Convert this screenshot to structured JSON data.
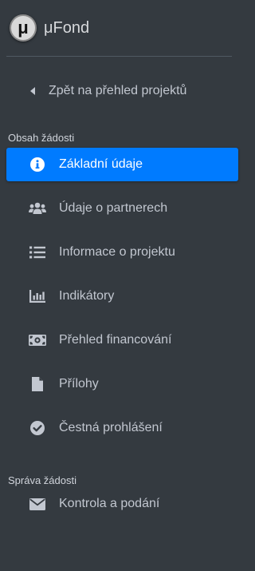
{
  "brand": {
    "logo_letter": "μ",
    "name": "μFond"
  },
  "back": {
    "label": "Zpět na přehled projektů"
  },
  "sections": [
    {
      "header": "Obsah žádosti",
      "items": [
        {
          "label": "Základní údaje",
          "icon": "info-circle-icon",
          "active": true
        },
        {
          "label": "Údaje o partnerech",
          "icon": "users-icon",
          "active": false
        },
        {
          "label": "Informace o projektu",
          "icon": "list-icon",
          "active": false
        },
        {
          "label": "Indikátory",
          "icon": "bar-chart-icon",
          "active": false
        },
        {
          "label": "Přehled financování",
          "icon": "money-bill-icon",
          "active": false
        },
        {
          "label": "Přílohy",
          "icon": "file-icon",
          "active": false
        },
        {
          "label": "Čestná prohlášení",
          "icon": "check-circle-icon",
          "active": false
        }
      ]
    },
    {
      "header": "Správa žádosti",
      "items": [
        {
          "label": "Kontrola a podání",
          "icon": "envelope-icon",
          "active": false
        }
      ]
    }
  ],
  "colors": {
    "sidebar_bg": "#343a40",
    "active_bg": "#007bff",
    "text": "#c2c7d0"
  }
}
